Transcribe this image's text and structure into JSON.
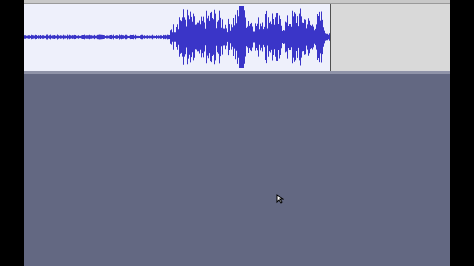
{
  "app": {
    "background_color": "#636882",
    "track_color": "#eef0fb",
    "waveform_color": "#3a35c8",
    "centerline_color": "#4b4fc2"
  },
  "track": {
    "waveform_icon": "audio-waveform",
    "cursor_icon": "mouse-pointer-icon"
  }
}
